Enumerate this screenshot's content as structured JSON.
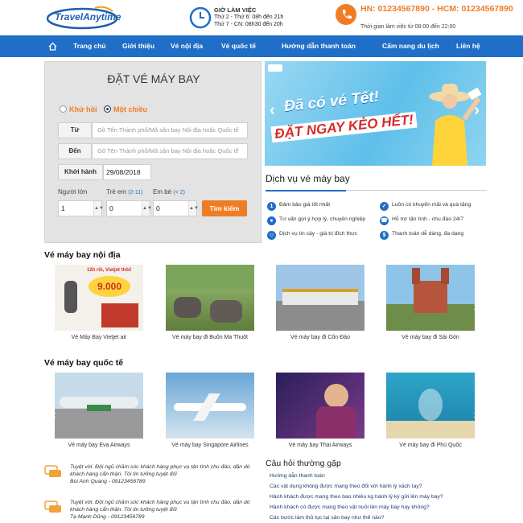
{
  "header": {
    "logo": "TravelAnytime",
    "hours_title": "GIỜ LÀM VIỆC",
    "hours_line1": "Thứ 2 - Thứ 6: 08h đến 21h",
    "hours_line2": "Thứ 7 - CN: 08h30 đến 20h",
    "hotline": "HN: 01234567890 - HCM: 01234567890",
    "worktime": "Thời gian làm việc từ 08:00 đến 22:00"
  },
  "nav": {
    "home_icon": "home-icon",
    "items": [
      "Trang chủ",
      "Giới thiệu",
      "Vé nội địa",
      "Vé quốc tế",
      "Hướng dẫn thanh toán",
      "Cẩm nang du lịch",
      "Liên hệ"
    ]
  },
  "booking": {
    "title": "ĐẶT VÉ MÁY BAY",
    "round_trip": "Khứ hồi",
    "one_way": "Một chiều",
    "from_label": "Từ",
    "from_placeholder": "Gõ Tên Thành phố/Mã sân bay Nội địa hoặc Quốc tế",
    "to_label": "Đến",
    "to_placeholder": "Gõ Tên Thành phố/Mã sân bay Nội địa hoặc Quốc tế",
    "depart_label": "Khởi hành",
    "depart_value": "29/08/2018",
    "adult_label": "Người lớn",
    "child_label": "Trẻ em",
    "child_note": "(2-11)",
    "infant_label": "Em bé",
    "infant_note": "(< 2)",
    "adult_value": "1",
    "child_value": "0",
    "infant_value": "0",
    "search_button": "Tìm kiếm"
  },
  "banner": {
    "line1": "Đã có vé Tết!",
    "line2": "ĐẶT NGAY KẺO HẾT!"
  },
  "services": {
    "title": "Dịch vụ vé máy bay",
    "items": [
      "Đảm bảo giá tốt nhất",
      "Luôn có khuyến mãi và quà tặng",
      "Tư vấn gợi ý hợp lý, chuyên nghiệp",
      "Hỗ trợ tận tình - chu đáo 24/7",
      "Dịch vụ tin cậy - giá trị đích thực",
      "Thanh toán dễ dàng, đa dạng"
    ]
  },
  "domestic": {
    "title": "Vé máy bay nội địa",
    "promo_text": "12h rồi, Vietjet thôi!",
    "promo_price": "9.000",
    "cards": [
      "Vé Máy Bay Vietjet air",
      "Vé máy bay đi Buôn Ma Thuột",
      "Vé máy bay đi Côn Đảo",
      "Vé máy bay đi Sài Gòn"
    ]
  },
  "international": {
    "title": "Vé máy bay quốc tế",
    "cards": [
      "Vé máy bay Eva Airways",
      "Vé máy bay Singapore Airlines",
      "Vé máy bay Thai Airways",
      "Vé máy bay đi Phú Quốc"
    ]
  },
  "testimonials": [
    {
      "text": "Tuyệt vời. Đội ngũ chăm sóc khách hàng  phục vụ tận tình chu đáo, dặn dò khách hàng cẩn thận. Tôi tin tưởng tuyệt đối",
      "author": "Bùi Anh Quang - 09123456789"
    },
    {
      "text": "Tuyệt vời. Đội ngũ chăm sóc khách hàng  phục vụ tận tình chu đáo, dặn dò khách hàng cẩn thận. Tôi tin tưởng tuyệt đối",
      "author": "Tạ Mạnh Dũng - 09123456789"
    }
  ],
  "faq": {
    "title": "Câu hỏi thường gặp",
    "items": [
      "Hướng dẫn thanh toán",
      "Các vật dụng không được mang theo đối với hành lý xách tay?",
      "Hành khách được mang theo bao nhiêu kg hành lý ký gửi lên máy bay?",
      "Hành khách có được mang theo vật nuôi lên máy bay hay không?",
      "Các bước làm thủ tục tại sân bay như thế nào?"
    ]
  },
  "colors": {
    "brand_blue": "#1f6ec7",
    "accent_orange": "#f07c24"
  }
}
